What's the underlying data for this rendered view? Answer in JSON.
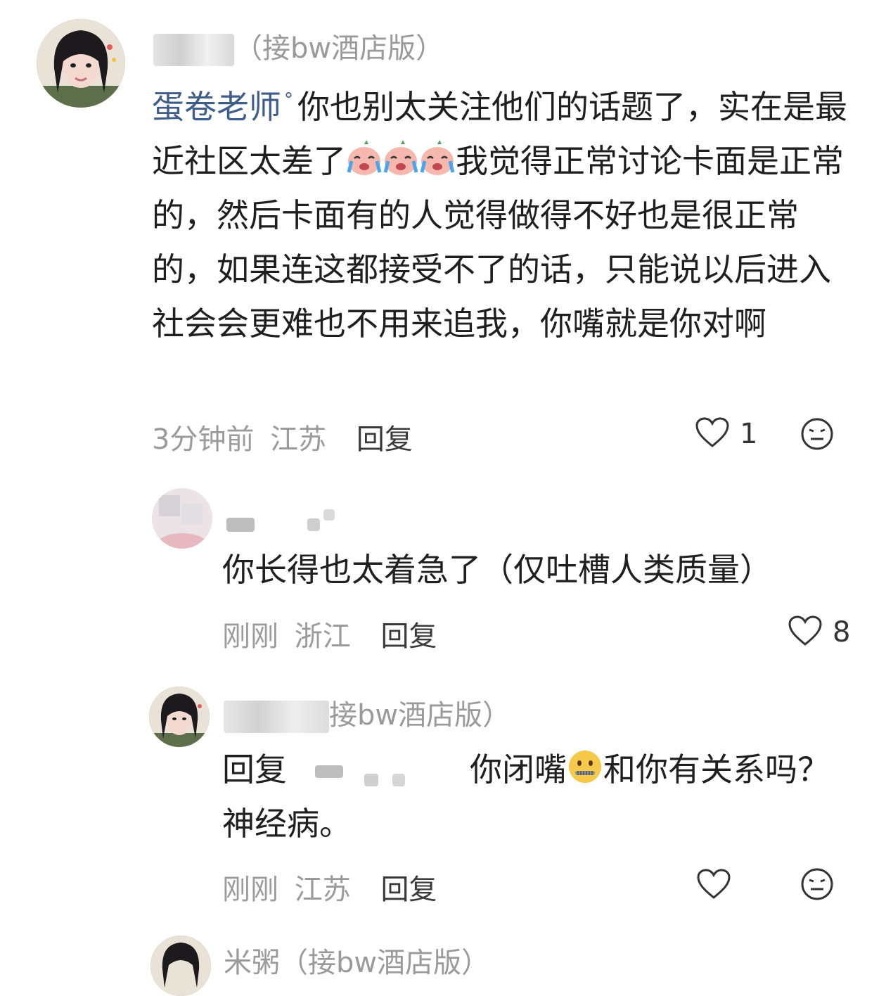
{
  "comments": [
    {
      "username_suffix": "（接bw酒店版）",
      "mention": "蛋卷老师",
      "text": "你也别太关注他们的话题了，实在是最近社区太差了",
      "text_after_emoji": "我觉得正常讨论卡面是正常的，然后卡面有的人觉得做得不好也是很正常的，如果连这都接受不了的话，只能说以后进入社会会更难也不用来追我，你嘴就是你对啊",
      "time": "3分钟前",
      "region": "江苏",
      "reply_label": "回复",
      "like_count": "1"
    },
    {
      "text": "你长得也太着急了（仅吐槽人类质量）",
      "time": "刚刚",
      "region": "浙江",
      "reply_label": "回复",
      "like_count": "8"
    },
    {
      "username_suffix": "接bw酒店版）",
      "reply_prefix": "回复",
      "text_before_emoji": "你闭嘴",
      "text_after_emoji": "和你有关系吗？神经病。",
      "time": "刚刚",
      "region": "江苏",
      "reply_label": "回复"
    },
    {
      "username_partial": "米粥（接bw酒店版）"
    }
  ],
  "icons": {
    "like": "heart-outline-icon",
    "dislike": "meh-face-icon",
    "emoji_cry": "crying-face-icon",
    "emoji_zip": "zipper-mouth-face-icon"
  },
  "colors": {
    "mention": "#3f5d8a",
    "meta": "#9b9b9b",
    "text": "#1f1f1f"
  }
}
